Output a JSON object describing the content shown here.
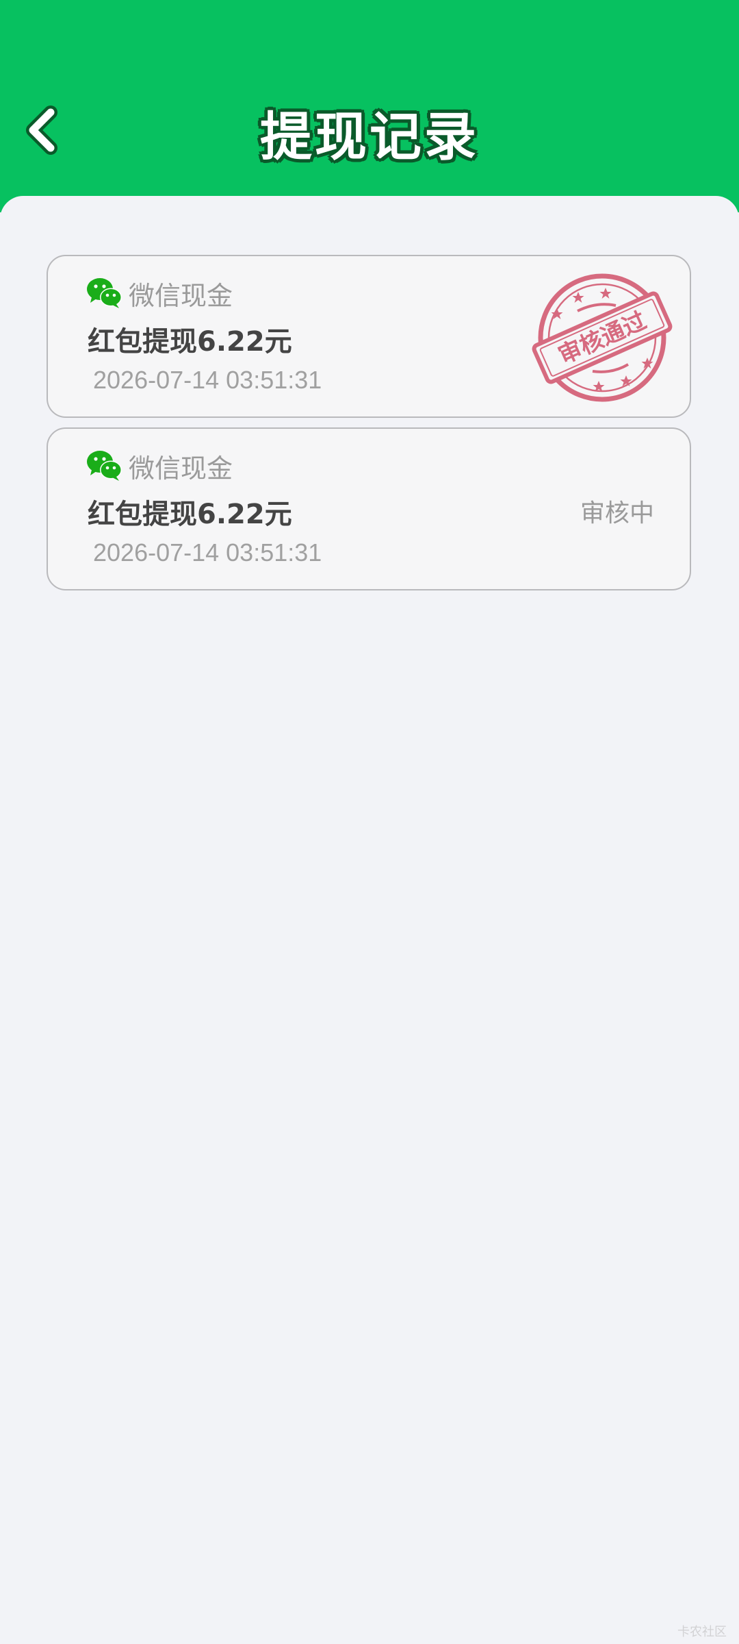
{
  "header": {
    "title": "提现记录",
    "background_color": "#07c160",
    "back_icon": "chevron-left-icon"
  },
  "records": [
    {
      "method": "微信现金",
      "method_icon": "wechat-icon",
      "title": "红包提现6.22元",
      "time": "2026-07-14 03:51:31",
      "status": "审核通过",
      "status_display": "stamp",
      "stamp_color": "#d66a7f"
    },
    {
      "method": "微信现金",
      "method_icon": "wechat-icon",
      "title": "红包提现6.22元",
      "time": "2026-07-14 03:51:31",
      "status": "审核中",
      "status_display": "text"
    }
  ],
  "watermark": "卡农社区"
}
